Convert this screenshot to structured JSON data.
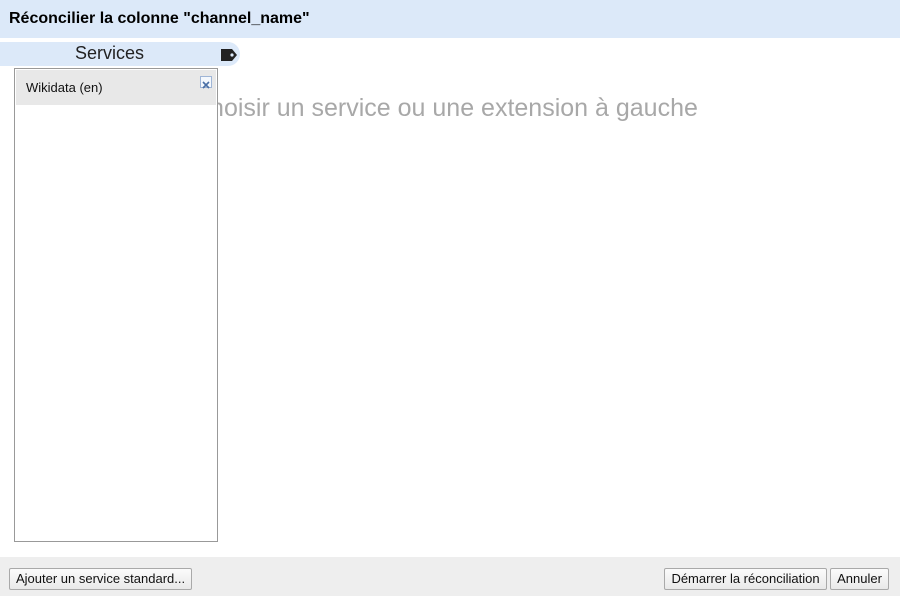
{
  "dialog": {
    "title": "Réconcilier la colonne \"channel_name\""
  },
  "sidebar": {
    "tab_label": "Services",
    "tab_icon": "tag-icon",
    "services": [
      {
        "label": "Wikidata (en)",
        "remove_icon": "close-icon"
      }
    ]
  },
  "main": {
    "empty_message": "Choisir un service ou une extension à gauche"
  },
  "footer": {
    "add_service_label": "Ajouter un service standard...",
    "start_label": "Démarrer la réconciliation",
    "cancel_label": "Annuler"
  },
  "colors": {
    "header_bg": "#dce9f9",
    "footer_bg": "#eeeeee",
    "service_item_bg": "#e8e8e8",
    "empty_message_text": "#a8a8a8"
  }
}
